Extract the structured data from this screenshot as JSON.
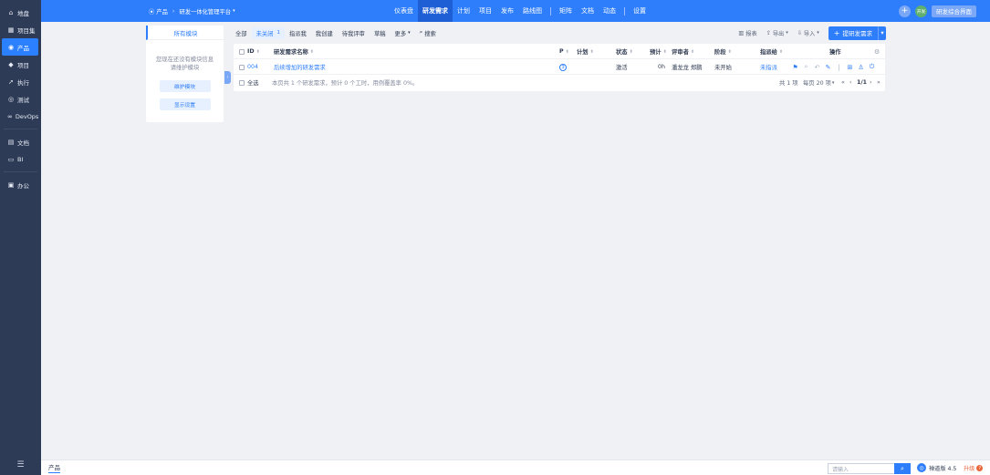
{
  "sidebar": {
    "items": [
      {
        "label": "地盘",
        "icon": "home-icon",
        "glyph": "⌂"
      },
      {
        "label": "项目集",
        "icon": "grid-icon",
        "glyph": "▦"
      },
      {
        "label": "产品",
        "icon": "location-pin-icon",
        "glyph": "◉"
      },
      {
        "label": "项目",
        "icon": "project-icon",
        "glyph": "◆"
      },
      {
        "label": "执行",
        "icon": "rocket-icon",
        "glyph": "➚"
      },
      {
        "label": "测试",
        "icon": "test-icon",
        "glyph": "◎"
      },
      {
        "label": "DevOps",
        "icon": "devops-icon",
        "glyph": "∞"
      },
      {
        "label": "文档",
        "icon": "doc-icon",
        "glyph": "▤"
      },
      {
        "label": "BI",
        "icon": "monitor-icon",
        "glyph": "▭"
      },
      {
        "label": "办公",
        "icon": "office-icon",
        "glyph": "▣"
      }
    ],
    "active_index": 2
  },
  "topbar": {
    "breadcrumb_root": "产品",
    "breadcrumb_product": "研发一体化管理平台",
    "nav": [
      "仪表盘",
      "研发需求",
      "计划",
      "项目",
      "发布",
      "路线图",
      "矩阵",
      "文档",
      "动态",
      "设置"
    ],
    "nav_active": "研发需求",
    "avatar_text": "开发",
    "interface_button": "研发综合界面"
  },
  "module_panel": {
    "tab": "所有模块",
    "empty_line1": "您现在还没有模块信息",
    "empty_line2": "请维护模块",
    "maintain_button": "维护模块",
    "display_button": "显示设置"
  },
  "filters": {
    "tabs": [
      "全部",
      "未关闭",
      "指派我",
      "我创建",
      "待我评审",
      "草稿",
      "更多"
    ],
    "active_tab": "未关闭",
    "active_count": "1",
    "search_label": "搜索",
    "report_label": "报表",
    "export_label": "导出",
    "import_label": "导入",
    "create_label": "提研发需求"
  },
  "table": {
    "headers": {
      "id": "ID",
      "name": "研发需求名称",
      "priority": "P",
      "plan": "计划",
      "status": "状态",
      "estimate": "预计",
      "reviewer": "评审者",
      "stage": "阶段",
      "assigned": "指派给",
      "actions": "操作"
    },
    "rows": [
      {
        "id": "004",
        "name": "后续增加的研发需求",
        "priority": "3",
        "plan": "",
        "status": "激活",
        "estimate": "0h",
        "reviewer": "潘龙龙 郑鹏",
        "stage": "未开始",
        "assigned": "未指派"
      }
    ],
    "select_all": "全选",
    "summary": "本页共 1 个研发需求，预计 0 个工时，用例覆盖率 0%。",
    "total_label": "共 1 项",
    "per_page_label": "每页 20 项",
    "page_label": "1/1"
  },
  "bottombar": {
    "product_label": "产品",
    "search_placeholder": "请输入",
    "version_label": "禅道版 4.5",
    "upgrade_label": "升级"
  },
  "colors": {
    "primary": "#2e7efb",
    "sidebar_bg": "#2e3b57",
    "page_bg": "#eff1f5",
    "upgrade": "#e8663a"
  }
}
